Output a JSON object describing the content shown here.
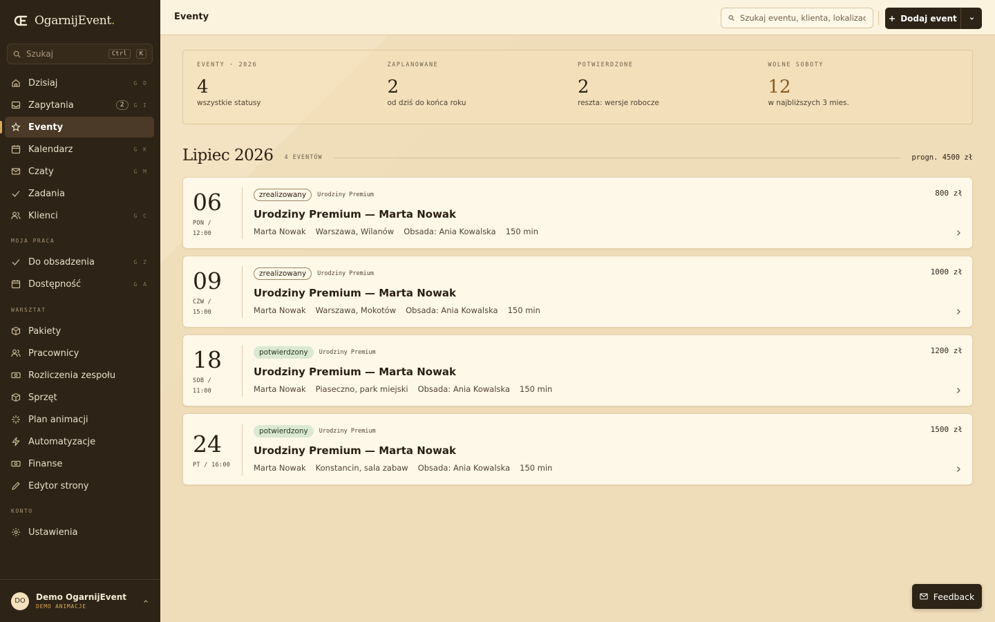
{
  "brand": {
    "name": "OgarnijEvent",
    "dot": "."
  },
  "sidebar": {
    "search": {
      "placeholder": "Szukaj",
      "kbd1": "Ctrl",
      "kbd2": "K"
    },
    "main": [
      {
        "label": "Dzisiaj",
        "shortcut": "G D",
        "icon": "home-icon"
      },
      {
        "label": "Zapytania",
        "shortcut": "G I",
        "badge": "2",
        "icon": "inbox-icon"
      },
      {
        "label": "Eventy",
        "shortcut": "",
        "icon": "star-icon",
        "active": true
      },
      {
        "label": "Kalendarz",
        "shortcut": "G K",
        "icon": "calendar-icon"
      },
      {
        "label": "Czaty",
        "shortcut": "G M",
        "icon": "mail-icon"
      },
      {
        "label": "Zadania",
        "shortcut": "",
        "icon": "check-icon"
      },
      {
        "label": "Klienci",
        "shortcut": "G C",
        "icon": "users-icon"
      }
    ],
    "section_work": "MOJA PRACA",
    "work": [
      {
        "label": "Do obsadzenia",
        "shortcut": "G Z",
        "icon": "check-icon"
      },
      {
        "label": "Dostępność",
        "shortcut": "G A",
        "icon": "calendar-icon"
      }
    ],
    "section_workshop": "WARSZTAT",
    "workshop": [
      {
        "label": "Pakiety",
        "icon": "box-icon"
      },
      {
        "label": "Pracownicy",
        "icon": "users-icon"
      },
      {
        "label": "Rozliczenia zespołu",
        "icon": "banknote-icon"
      },
      {
        "label": "Sprzęt",
        "icon": "box-icon"
      },
      {
        "label": "Plan animacji",
        "icon": "sparkle-icon"
      },
      {
        "label": "Automatyzacje",
        "icon": "zap-icon"
      },
      {
        "label": "Finanse",
        "icon": "banknote-icon"
      },
      {
        "label": "Edytor strony",
        "icon": "pencil-icon"
      }
    ],
    "section_account": "KONTO",
    "account": [
      {
        "label": "Ustawienia",
        "icon": "gear-icon"
      }
    ],
    "user": {
      "initials": "DO",
      "name": "Demo OgarnijEvent",
      "role": "DEMO ANIMACJE"
    }
  },
  "topbar": {
    "title": "Eventy",
    "search_placeholder": "Szukaj eventu, klienta, lokalizacji...",
    "add_label": "Dodaj event"
  },
  "stats": [
    {
      "label": "EVENTY · 2026",
      "value": "4",
      "sub": "wszystkie statusy"
    },
    {
      "label": "ZAPLANOWANE",
      "value": "2",
      "sub": "od dziś do końca roku"
    },
    {
      "label": "POTWIERDZONE",
      "value": "2",
      "sub": "reszta: wersje robocze"
    },
    {
      "label": "WOLNE SOBOTY",
      "value": "12",
      "sub": "w najbliższych 3 mies.",
      "accent": "#8a5a1c"
    }
  ],
  "month": {
    "title": "Lipiec 2026",
    "count": "4 EVENTÓW",
    "forecast": "progn. 4500 zł"
  },
  "events": [
    {
      "day": "06",
      "when1": "PON /",
      "when2": "12:00",
      "status": "zrealizowany",
      "status_kind": "done",
      "package": "Urodziny Premium",
      "title": "Urodziny Premium — Marta Nowak",
      "client": "Marta Nowak",
      "location": "Warszawa, Wilanów",
      "staff": "Obsada: Ania Kowalska",
      "duration": "150 min",
      "price": "800 zł"
    },
    {
      "day": "09",
      "when1": "CZW /",
      "when2": "15:00",
      "status": "zrealizowany",
      "status_kind": "done",
      "package": "Urodziny Premium",
      "title": "Urodziny Premium — Marta Nowak",
      "client": "Marta Nowak",
      "location": "Warszawa, Mokotów",
      "staff": "Obsada: Ania Kowalska",
      "duration": "150 min",
      "price": "1000 zł"
    },
    {
      "day": "18",
      "when1": "SOB /",
      "when2": "11:00",
      "status": "potwierdzony",
      "status_kind": "ok",
      "package": "Urodziny Premium",
      "title": "Urodziny Premium — Marta Nowak",
      "client": "Marta Nowak",
      "location": "Piaseczno, park miejski",
      "staff": "Obsada: Ania Kowalska",
      "duration": "150 min",
      "price": "1200 zł"
    },
    {
      "day": "24",
      "when1": "PT / 16:00",
      "when2": "",
      "status": "potwierdzony",
      "status_kind": "ok",
      "package": "Urodziny Premium",
      "title": "Urodziny Premium — Marta Nowak",
      "client": "Marta Nowak",
      "location": "Konstancin, sala zabaw",
      "staff": "Obsada: Ania Kowalska",
      "duration": "150 min",
      "price": "1500 zł"
    }
  ],
  "feedback": {
    "label": "Feedback"
  },
  "colors": {
    "sidebar": "#2d2316",
    "accent": "#d9a85a",
    "background": "#efdcb8",
    "confirmed": "#dbe8d2"
  }
}
